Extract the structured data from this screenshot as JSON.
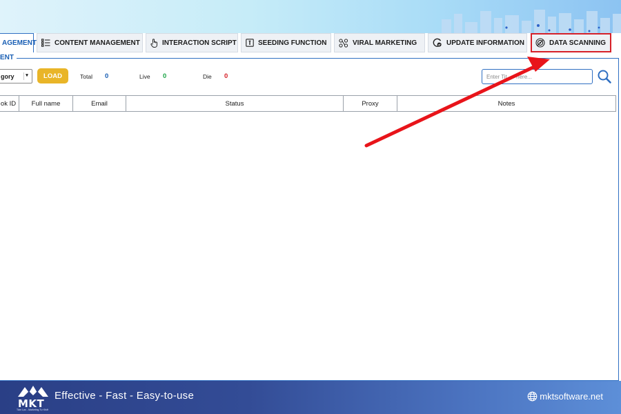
{
  "tabs": [
    {
      "label": "AGEMENT",
      "icon": "",
      "active": true
    },
    {
      "label": "CONTENT MANAGEMENT",
      "icon": "list-icon"
    },
    {
      "label": "INTERACTION SCRIPT",
      "icon": "hand-pointer-icon"
    },
    {
      "label": "SEEDING FUNCTION",
      "icon": "seed-box-icon"
    },
    {
      "label": "VIRAL MARKETING",
      "icon": "share-nodes-icon"
    },
    {
      "label": "UPDATE INFORMATION",
      "icon": "refresh-check-icon"
    },
    {
      "label": "DATA SCANNING",
      "icon": "radar-icon",
      "highlighted": true
    }
  ],
  "panel": {
    "legend": "ENT"
  },
  "toolbar": {
    "category_value": "gory",
    "load_label": "LOAD",
    "total_label": "Total",
    "total_value": "0",
    "live_label": "Live",
    "live_value": "0",
    "die_label": "Die",
    "die_value": "0",
    "search_placeholder": "Enter Tit...   here..."
  },
  "table": {
    "columns": [
      "ok ID",
      "Full name",
      "Email",
      "Status",
      "Proxy",
      "Notes"
    ]
  },
  "footer": {
    "logo": "MKT",
    "logo_sub": "Tâm Lực - Marketing Tự Khởi",
    "tagline": "Effective - Fast - Easy-to-use",
    "website": "mktsoftware.net"
  },
  "colors": {
    "accent": "#2f6fc2",
    "load": "#e9b528",
    "total": "#1a5fb4",
    "live": "#1fa64a",
    "die": "#d62028",
    "annotation": "#e8141a"
  }
}
